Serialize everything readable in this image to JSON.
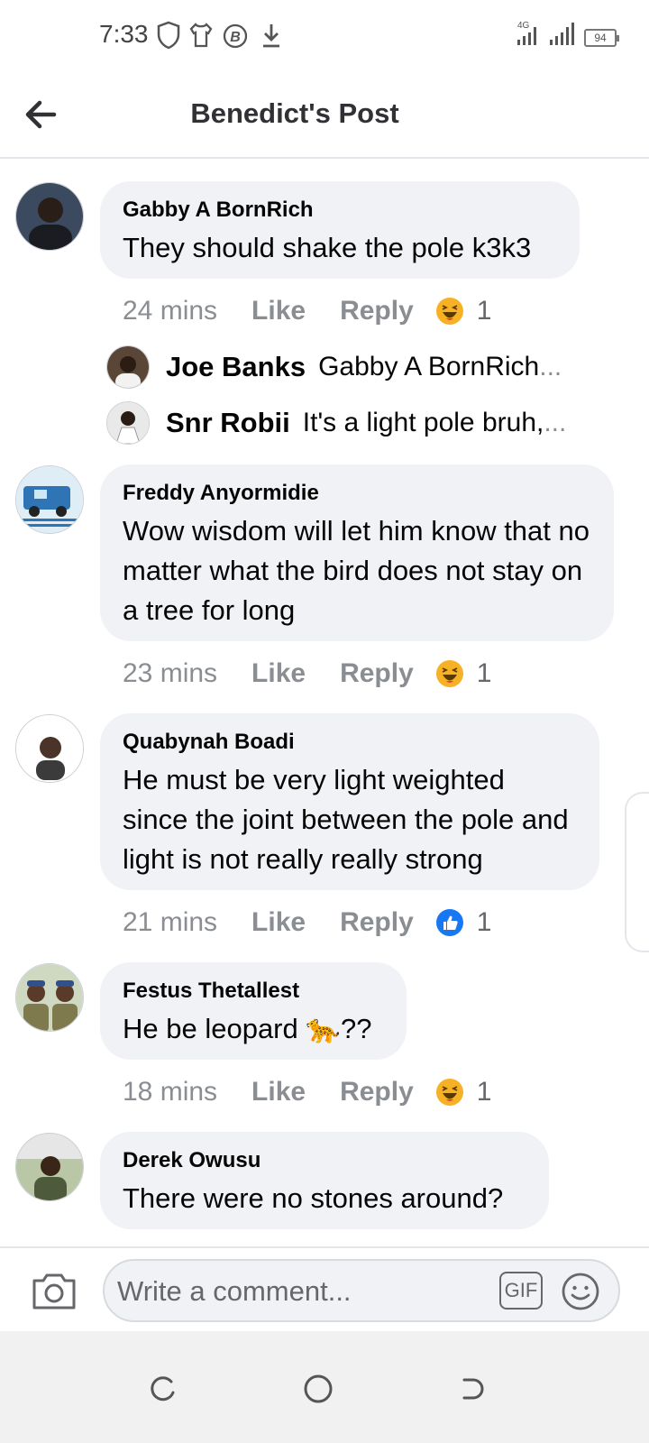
{
  "status_bar": {
    "time": "7:33",
    "network": "4G",
    "battery": "94"
  },
  "header": {
    "title": "Benedict's Post"
  },
  "comments": [
    {
      "author": "Gabby A BornRich",
      "text": "They should shake the pole k3k3",
      "time": "24 mins",
      "like": "Like",
      "reply": "Reply",
      "reaction": "haha",
      "reaction_count": "1",
      "replies": [
        {
          "author": "Joe Banks",
          "text": "Gabby A BornRich",
          "ellipsis": "..."
        },
        {
          "author": "Snr Robii",
          "text": "It's a light pole bruh,",
          "ellipsis": "..."
        }
      ]
    },
    {
      "author": "Freddy Anyormidie",
      "text": "Wow wisdom will let him know that no matter what the bird does not stay on a tree for long",
      "time": "23 mins",
      "like": "Like",
      "reply": "Reply",
      "reaction": "haha",
      "reaction_count": "1"
    },
    {
      "author": "Quabynah Boadi",
      "text": "He must be very light weighted since the joint between the pole and light is not really really strong",
      "time": "21 mins",
      "like": "Like",
      "reply": "Reply",
      "reaction": "like",
      "reaction_count": "1"
    },
    {
      "author": "Festus Thetallest",
      "text": "He be leopard",
      "text_suffix": "??",
      "emoji": "🐆",
      "time": "18 mins",
      "like": "Like",
      "reply": "Reply",
      "reaction": "haha",
      "reaction_count": "1"
    },
    {
      "author": "Derek Owusu",
      "text": "There were no stones around?"
    }
  ],
  "composer": {
    "placeholder": "Write a comment...",
    "gif_label": "GIF"
  },
  "colors": {
    "bubble": "#f0f2f5",
    "meta": "#8a8d91",
    "haha": "#f7b125",
    "like": "#1877f2"
  }
}
